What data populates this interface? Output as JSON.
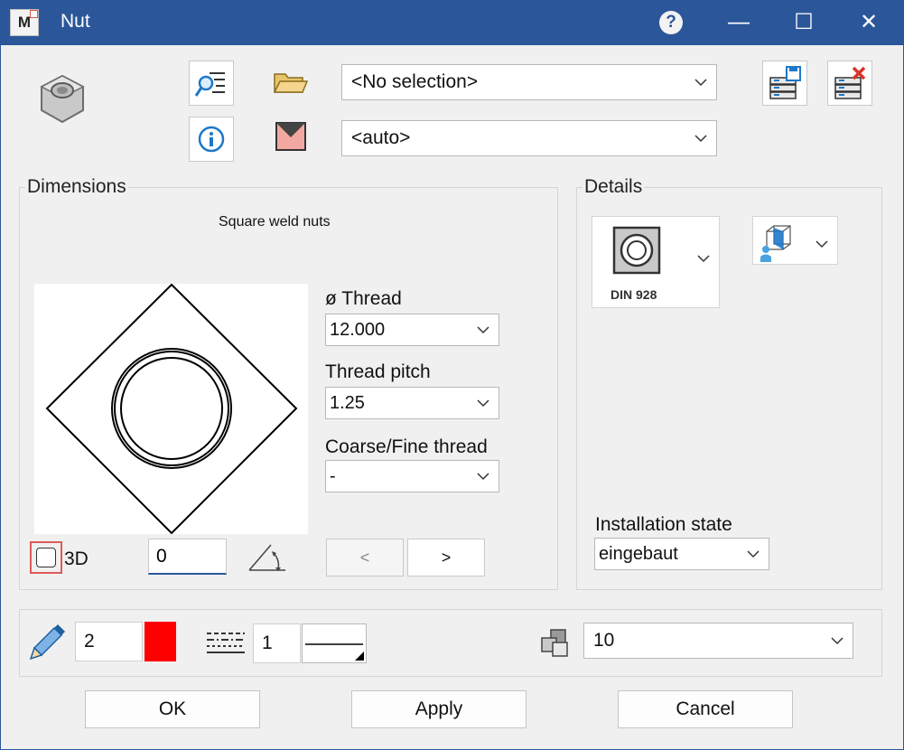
{
  "window": {
    "title": "Nut",
    "app_icon_letter": "M",
    "help_label": "?",
    "minimize_label": "—",
    "maximize_label": "☐",
    "close_label": "✕"
  },
  "toolbar": {
    "selection_value": "<No selection>",
    "auto_value": "<auto>"
  },
  "dimensions": {
    "label": "Dimensions",
    "caption": "Square weld nuts",
    "thread_label": "ø Thread",
    "thread_value": "12.000",
    "pitch_label": "Thread pitch",
    "pitch_value": "1.25",
    "coarse_label": "Coarse/Fine thread",
    "coarse_value": "-",
    "cb_3d_label": "3D",
    "cb_3d_checked": false,
    "angle_value": "0",
    "prev_label": "<",
    "next_label": ">"
  },
  "details": {
    "label": "Details",
    "din_label": "DIN 928",
    "install_label": "Installation state",
    "install_value": "eingebaut"
  },
  "bottom": {
    "pen_value": "2",
    "pen_color": "#ff0000",
    "line_value": "1",
    "layer_value": "10"
  },
  "buttons": {
    "ok": "OK",
    "apply": "Apply",
    "cancel": "Cancel"
  },
  "colors": {
    "titlebar": "#2b579a",
    "client": "#f0f0f0",
    "highlight": "#e05a5a"
  }
}
